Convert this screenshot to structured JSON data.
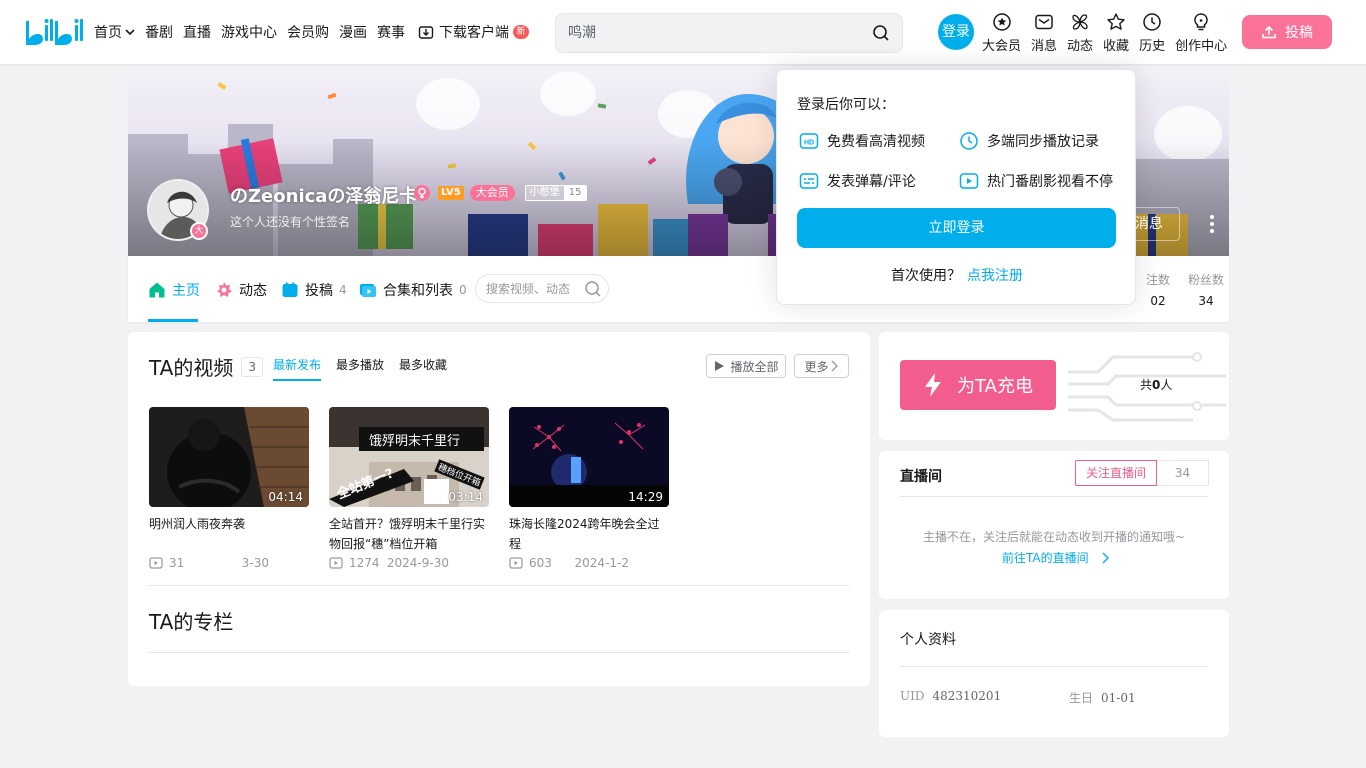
{
  "header": {
    "nav": [
      {
        "label": "首页"
      },
      {
        "label": "番剧"
      },
      {
        "label": "直播"
      },
      {
        "label": "游戏中心"
      },
      {
        "label": "会员购"
      },
      {
        "label": "漫画"
      },
      {
        "label": "赛事"
      }
    ],
    "download_label": "下载客户端",
    "download_badge": "新",
    "search_placeholder": "鸣潮",
    "login_label": "登录",
    "icons": [
      {
        "label": "大会员",
        "icon": "vip-icon"
      },
      {
        "label": "消息",
        "icon": "message-icon"
      },
      {
        "label": "动态",
        "icon": "dynamic-icon"
      },
      {
        "label": "收藏",
        "icon": "favorite-icon"
      },
      {
        "label": "历史",
        "icon": "history-icon"
      },
      {
        "label": "创作中心",
        "icon": "creator-icon"
      }
    ],
    "upload_label": "投稿"
  },
  "banner": {
    "username": "のZeonicaの泽翁尼卡",
    "level": "LV5",
    "vip_label": "大会员",
    "fan_medal": "小憨堡",
    "fan_level": "15",
    "avatar_badge": "大",
    "signature": "这个人还没有个性签名",
    "message_label": "消息"
  },
  "tabs": {
    "items": [
      {
        "label": "主页",
        "count": ""
      },
      {
        "label": "动态",
        "count": ""
      },
      {
        "label": "投稿",
        "count": "4"
      },
      {
        "label": "合集和列表",
        "count": "0"
      }
    ],
    "search_placeholder": "搜索视频、动态",
    "stats": [
      {
        "label": "注数",
        "value": "02"
      },
      {
        "label": "粉丝数",
        "value": "34"
      }
    ]
  },
  "videos_section": {
    "title": "TA的视频",
    "count": "3",
    "sorts": [
      "最新发布",
      "最多播放",
      "最多收藏"
    ],
    "play_all": "播放全部",
    "more": "更多",
    "videos": [
      {
        "title": "明州润人雨夜奔袭",
        "duration": "04:14",
        "plays": "31",
        "date": "3-30"
      },
      {
        "title": "全站首开？饿殍明末千里行实物回报“穗”档位开箱",
        "duration": "03:14",
        "plays": "1274",
        "date": "2024-9-30",
        "overlay_main": "饿殍明末千里行",
        "overlay_sub": "全站第一?",
        "overlay_tag": "穗档位开箱"
      },
      {
        "title": "珠海长隆2024跨年晚会全过程",
        "duration": "14:29",
        "plays": "603",
        "date": "2024-1-2"
      }
    ]
  },
  "column_section": {
    "title": "TA的专栏"
  },
  "charge": {
    "button_label": "为TA充电",
    "total_prefix": "共",
    "total": "0",
    "total_suffix": "人"
  },
  "live": {
    "title": "直播间",
    "follow_label": "关注直播间",
    "follow_count": "34",
    "tip": "主播不在，关注后就能在动态收到开播的通知哦~",
    "link": "前往TA的直播间"
  },
  "profile": {
    "title": "个人资料",
    "uid_label": "UID",
    "uid": "482310201",
    "birthday_label": "生日",
    "birthday": "01-01"
  },
  "login_popup": {
    "heading": "登录后你可以：",
    "features": [
      "免费看高清视频",
      "多端同步播放记录",
      "发表弹幕/评论",
      "热门番剧影视看不停"
    ],
    "button": "立即登录",
    "register_prefix": "首次使用？",
    "register_link": "点我注册"
  },
  "colors": {
    "accent": "#00aeec",
    "pink": "#fb7299",
    "charge": "#f25d8e"
  }
}
